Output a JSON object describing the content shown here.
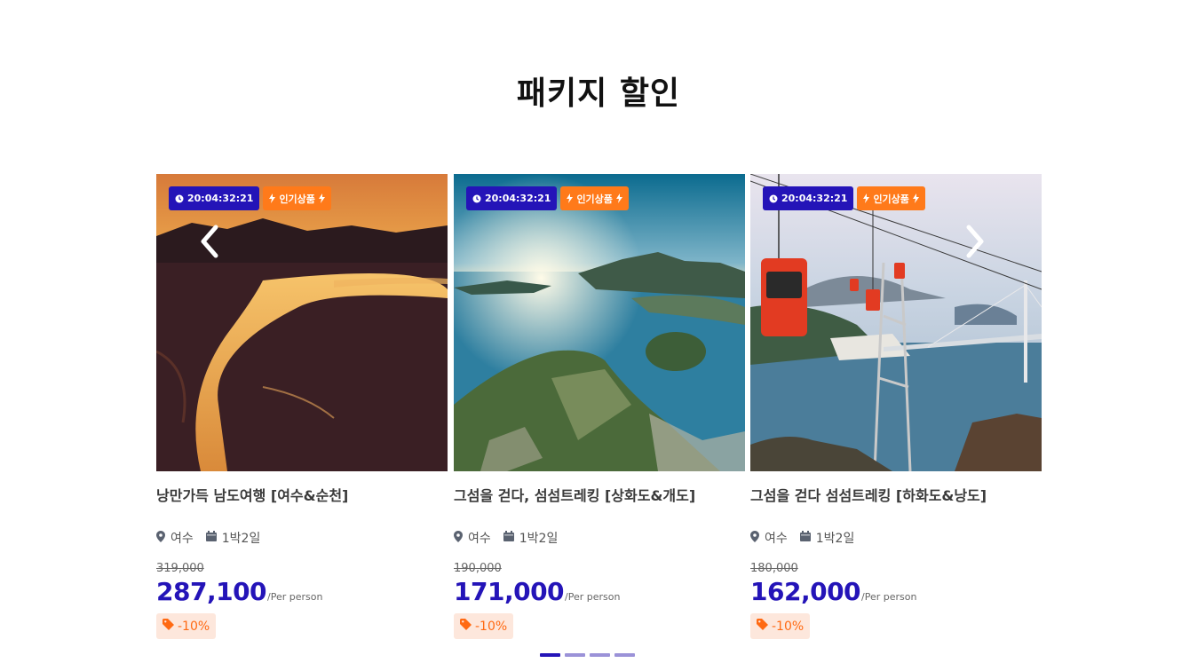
{
  "section": {
    "title": "패키지 할인"
  },
  "cards": [
    {
      "timer": "20:04:32:21",
      "badge": "인기상품",
      "title": "낭만가득 남도여행 [여수&순천]",
      "location": "여수",
      "duration": "1박2일",
      "old_price": "319,000",
      "price": "287,100",
      "per": "/Per person",
      "discount": "-10%",
      "image": "sunset-river-tidal-flat"
    },
    {
      "timer": "20:04:32:21",
      "badge": "인기상품",
      "title": "그섬을 걷다, 섬섬트레킹 [상화도&개도]",
      "location": "여수",
      "duration": "1박2일",
      "old_price": "190,000",
      "price": "171,000",
      "per": "/Per person",
      "discount": "-10%",
      "image": "coastal-city-aerial"
    },
    {
      "timer": "20:04:32:21",
      "badge": "인기상품",
      "title": "그섬을 걷다 섬섬트레킹 [하화도&낭도]",
      "location": "여수",
      "duration": "1박2일",
      "old_price": "180,000",
      "price": "162,000",
      "per": "/Per person",
      "discount": "-10%",
      "image": "cable-car-bridge"
    }
  ],
  "nav": {
    "prev_icon": "chevron-left-icon",
    "next_icon": "chevron-right-icon"
  },
  "pagination": {
    "count": 4,
    "active": 0
  },
  "colors": {
    "primary": "#2414b8",
    "accent": "#ff7a1a",
    "discount_bg": "#fde7dc"
  }
}
